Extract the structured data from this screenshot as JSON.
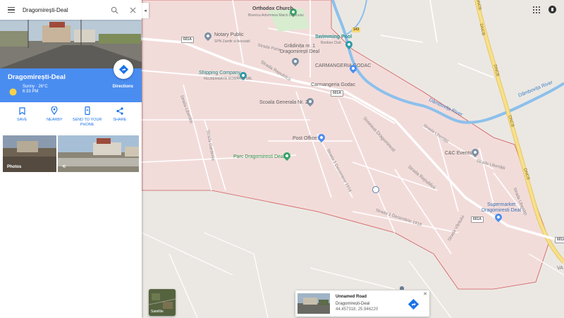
{
  "search": {
    "value": "Dragomirești-Deal"
  },
  "place": {
    "title": "Dragomirești-Deal",
    "weather": "Sunny · 26°C",
    "time": "6:33 PM",
    "directions_label": "Directions"
  },
  "actions": [
    {
      "label": "SAVE"
    },
    {
      "label": "NEARBY"
    },
    {
      "label": "SEND TO YOUR PHONE"
    },
    {
      "label": "SHARE"
    }
  ],
  "photos": {
    "caption": "Photos"
  },
  "map": {
    "pois": {
      "church": "Orthodox Church",
      "church_sub": "Biserica Adormirea Maicii Domnului",
      "notary": "Notary Public",
      "notary_sub": "SPN Zamfir si Asociatii",
      "kindergarten": "Grădinița nr. 1 Dragomirești Deal",
      "pool": "Swimming Pool",
      "pool_sub": "Bonbon Club",
      "shipping": "Shipping Company",
      "shipping_sub": "FELBERMAYR ROMÂNIA SRL",
      "carmangeria1": "CARMANGERIA GODAC",
      "carmangeria2": "Carmangeria Godac",
      "school": "Scoala Generala Nr. 2",
      "post": "Post Office",
      "park": "Parc Dragomiresti Deal",
      "events": "C&C Events",
      "supermarket": "Supermarket Dragomiresti Deal"
    },
    "streets": {
      "paris": "Strada Paris",
      "republicii1": "Strada Republicii",
      "republicii2": "Strada Republicii",
      "dragomiresti": "Soseaua Dragomiresti",
      "libertatii1": "Strada Libertății",
      "libertatii2": "Strada Libertății",
      "dec1": "Strada 1 Decembrie 1918",
      "dec2": "Strada 1 Decembrie 1918",
      "vantului": "Strada Vântului",
      "gardenia": "Strada Gardenia",
      "sub1": "Strada Libertății",
      "sub2": "Strada Libertății"
    },
    "roads": {
      "dncb1": "DNCB",
      "dncb2": "DNCB",
      "dncb3": "DNCB",
      "dncb4": "DNCB",
      "dncb5": "DNCB",
      "r601a_1": "601A",
      "r601a_2": "601A",
      "r601a_3": "601A",
      "r601a_4": "601A",
      "r143": "143"
    },
    "river": "Dâmbovița River",
    "river2": "Dâmbovița River",
    "edge_label": "VA"
  },
  "satellite": {
    "label": "Satellite"
  },
  "info_card": {
    "title": "Unnamed Road",
    "subtitle": "Dragomirești-Deal",
    "coords": "44.457318, 25.946220"
  },
  "colors": {
    "accent": "#4a8df0",
    "boundary": "#c94a4a",
    "area_fill": "#f3d8d6",
    "river": "#7ab6e8",
    "highway": "#f5d87a"
  }
}
